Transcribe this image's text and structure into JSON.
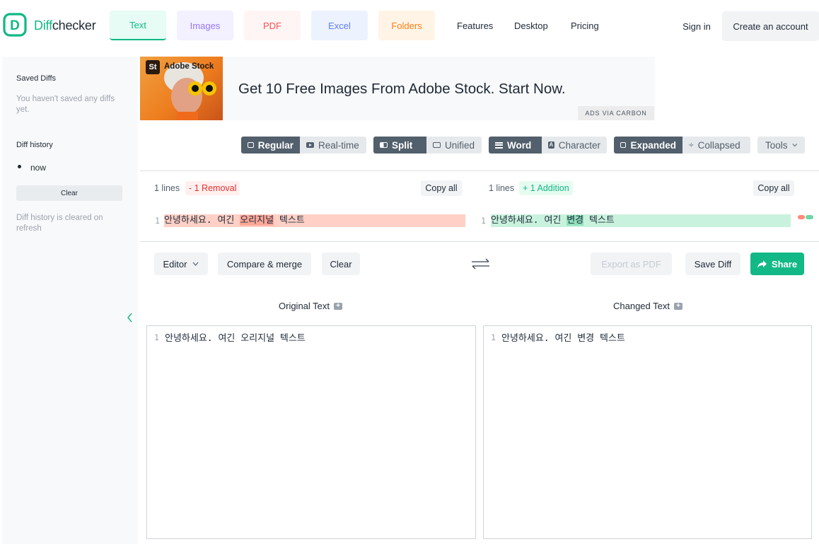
{
  "brand": {
    "name_part1": "Diff",
    "name_part2": "checker"
  },
  "nav": {
    "tabs": [
      {
        "label": "Text",
        "color": "#12b886",
        "bg": "#e6fcf5"
      },
      {
        "label": "Images",
        "color": "#9775fa",
        "bg": "#f3f0ff"
      },
      {
        "label": "PDF",
        "color": "#fa5252",
        "bg": "#fff5f5"
      },
      {
        "label": "Excel",
        "color": "#5c7cfa",
        "bg": "#edf2ff"
      },
      {
        "label": "Folders",
        "color": "#fd7e14",
        "bg": "#fff4e6"
      }
    ],
    "links": [
      "Features",
      "Desktop",
      "Pricing"
    ],
    "sign_in": "Sign in",
    "create_account": "Create an account"
  },
  "sidebar": {
    "saved_title": "Saved Diffs",
    "saved_empty": "You haven't saved any diffs yet.",
    "history_title": "Diff history",
    "history_item": "now",
    "clear_button": "Clear",
    "history_note": "Diff history is cleared on refresh"
  },
  "ad": {
    "brand": "Adobe Stock",
    "brand_badge": "St",
    "headline": "Get 10 Free Images From Adobe Stock. Start Now.",
    "via": "ADS VIA CARBON"
  },
  "toolbar": {
    "regular": "Regular",
    "realtime": "Real-time",
    "split": "Split",
    "unified": "Unified",
    "word": "Word",
    "character": "Character",
    "expanded": "Expanded",
    "collapsed": "Collapsed",
    "tools": "Tools"
  },
  "diff": {
    "left": {
      "lines_label": "1 lines",
      "change_label": "- 1 Removal",
      "copy_label": "Copy all",
      "line_number": "1",
      "text_before": "안녕하세요. 여긴 ",
      "text_highlight": "오리지널",
      "text_after": " 텍스트"
    },
    "right": {
      "lines_label": "1 lines",
      "change_label": "+ 1 Addition",
      "copy_label": "Copy all",
      "line_number": "1",
      "text_before": "안녕하세요. 여긴 ",
      "text_highlight": "변경",
      "text_after": " 텍스트"
    }
  },
  "actions": {
    "editor": "Editor",
    "compare_merge": "Compare & merge",
    "clear": "Clear",
    "export_pdf": "Export as PDF",
    "save_diff": "Save Diff",
    "share": "Share"
  },
  "editors": {
    "original_title": "Original Text",
    "changed_title": "Changed Text",
    "original_line_number": "1",
    "original_text": "안녕하세요. 여긴 오리지널 텍스트",
    "changed_line_number": "1",
    "changed_text": "안녕하세요. 여긴 변경 텍스트"
  },
  "colors": {
    "accent": "#12b886",
    "removal_bg": "#ffd0c6",
    "removal_highlight": "#ffa899",
    "addition_bg": "#c9f2de",
    "addition_highlight": "#8fe0bb"
  }
}
